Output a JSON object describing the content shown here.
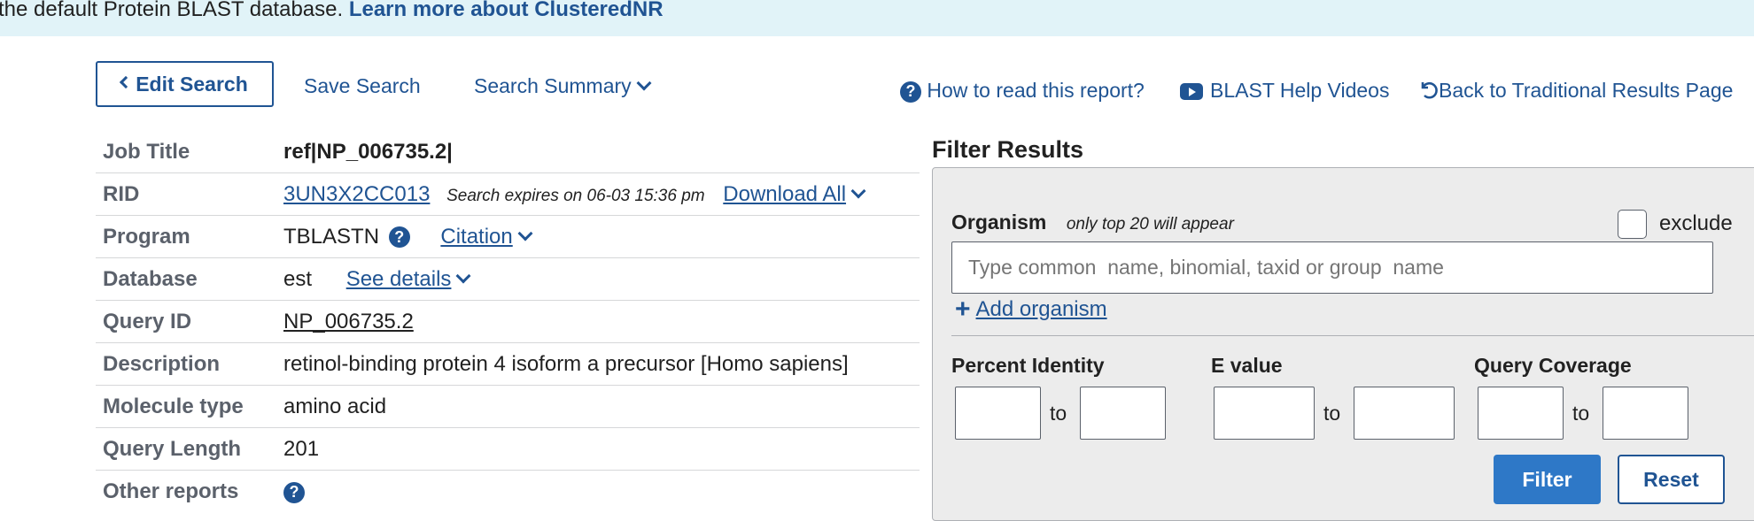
{
  "banner": {
    "text": "the default Protein BLAST database.",
    "link": "Learn more about ClusteredNR"
  },
  "toolbar": {
    "edit_search": "Edit Search",
    "save_search": "Save Search",
    "search_summary": "Search Summary",
    "how_to_read": "How to read this report?",
    "help_videos": "BLAST Help Videos",
    "back_traditional": "Back to Traditional Results Page"
  },
  "job": {
    "job_title_label": "Job Title",
    "job_title_value": "ref|NP_006735.2|",
    "rid_label": "RID",
    "rid_value": "3UN3X2CC013",
    "rid_expires": "Search expires on 06-03 15:36 pm",
    "download_all": "Download All",
    "program_label": "Program",
    "program_value": "TBLASTN",
    "citation": "Citation",
    "database_label": "Database",
    "database_value": "est",
    "see_details": "See details",
    "query_id_label": "Query ID",
    "query_id_value": "NP_006735.2",
    "description_label": "Description",
    "description_value": "retinol-binding protein 4 isoform a precursor [Homo sapiens]",
    "molecule_label": "Molecule type",
    "molecule_value": "amino acid",
    "query_length_label": "Query Length",
    "query_length_value": "201",
    "other_reports_label": "Other reports"
  },
  "filter": {
    "title": "Filter Results",
    "organism_label": "Organism",
    "organism_hint": "only top 20 will appear",
    "exclude_label": "exclude",
    "organism_placeholder": "Type common  name, binomial, taxid or group  name",
    "add_organism": "Add organism",
    "percent_identity_label": "Percent Identity",
    "evalue_label": "E value",
    "query_coverage_label": "Query Coverage",
    "to": "to",
    "filter_button": "Filter",
    "reset_button": "Reset"
  },
  "colors": {
    "link": "#205493",
    "banner_bg": "#e1f3f8",
    "primary_button": "#2e78c7",
    "panel_bg": "#ececec"
  }
}
